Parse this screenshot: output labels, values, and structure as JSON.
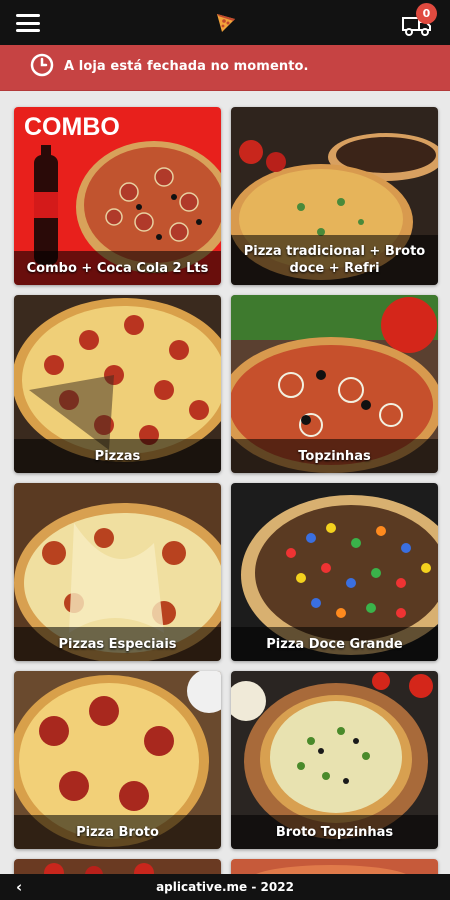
{
  "header": {
    "menu_icon": "hamburger-menu-icon",
    "logo_icon": "pizza-slice-logo",
    "cart_icon": "delivery-cart-icon",
    "cart_count": "0"
  },
  "notice": {
    "icon": "clock-icon",
    "text": "A loja está fechada no momento."
  },
  "categories": [
    {
      "label": "Combo + Coca Cola 2 Lts",
      "badge": "COMBO"
    },
    {
      "label": "Pizza tradicional + Broto doce + Refri"
    },
    {
      "label": "Pizzas"
    },
    {
      "label": "Topzinhas"
    },
    {
      "label": "Pizzas Especiais"
    },
    {
      "label": "Pizza Doce Grande"
    },
    {
      "label": "Pizza Broto"
    },
    {
      "label": "Broto Topzinhas"
    }
  ],
  "footer": {
    "back_icon": "chevron-left-icon",
    "back_glyph": "‹",
    "text": "aplicative.me - 2022"
  },
  "colors": {
    "topbar": "#121212",
    "notice": "#c64343",
    "badge": "#e04a3f",
    "background": "#e9e9e9"
  }
}
